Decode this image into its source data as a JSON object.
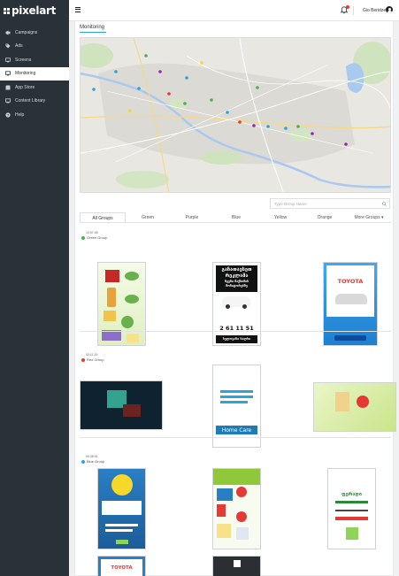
{
  "app": {
    "logo_text": "pixelart"
  },
  "sidebar": {
    "items": [
      {
        "label": "Campaigns",
        "icon": "megaphone-icon",
        "active": false
      },
      {
        "label": "Ads",
        "icon": "tag-icon",
        "active": false
      },
      {
        "label": "Screens",
        "icon": "screen-icon",
        "active": false
      },
      {
        "label": "Monitoring",
        "icon": "monitor-icon",
        "active": true
      },
      {
        "label": "App Store",
        "icon": "store-icon",
        "active": false
      },
      {
        "label": "Content Library",
        "icon": "library-icon",
        "active": false
      },
      {
        "label": "Help",
        "icon": "help-icon",
        "active": false
      }
    ]
  },
  "topbar": {
    "user_name": "Gio Beridze",
    "colors": {
      "notification_dot": "#e53935"
    }
  },
  "page": {
    "title": "Monitoring",
    "search_placeholder": "Type Group Name"
  },
  "tabs": [
    {
      "label": "All Groups",
      "active": true
    },
    {
      "label": "Green",
      "active": false
    },
    {
      "label": "Purple",
      "active": false
    },
    {
      "label": "Blue",
      "active": false
    },
    {
      "label": "Yellow",
      "active": false
    },
    {
      "label": "Orange",
      "active": false
    },
    {
      "label": "More Groups ▾",
      "active": false
    }
  ],
  "groups": [
    {
      "time": "12:07:45",
      "name": "Green Group",
      "color": "#4caf50"
    },
    {
      "time": "02:11:19",
      "name": "Red Group",
      "color": "#e53935"
    },
    {
      "time": "06:38:01",
      "name": "Blue Group",
      "color": "#2aa5d8"
    }
  ],
  "ads": {
    "georgian_ad_lines": [
      "გაჩათავსეთ",
      "რეკლამა",
      "ჩვენი მაქსიმის",
      "მონიტორებზე"
    ],
    "georgian_phone": "2 61 11 51",
    "georgian_footer": "ხელოვანი ხალხი",
    "toyota_brand": "TOYOTA",
    "home_care_text": "Home Care",
    "color_flyer_line": "ფერადი"
  },
  "colors": {
    "sidebar_bg": "#2a3239",
    "accent": "#2aa5d8",
    "toyota_red": "#e53935"
  }
}
